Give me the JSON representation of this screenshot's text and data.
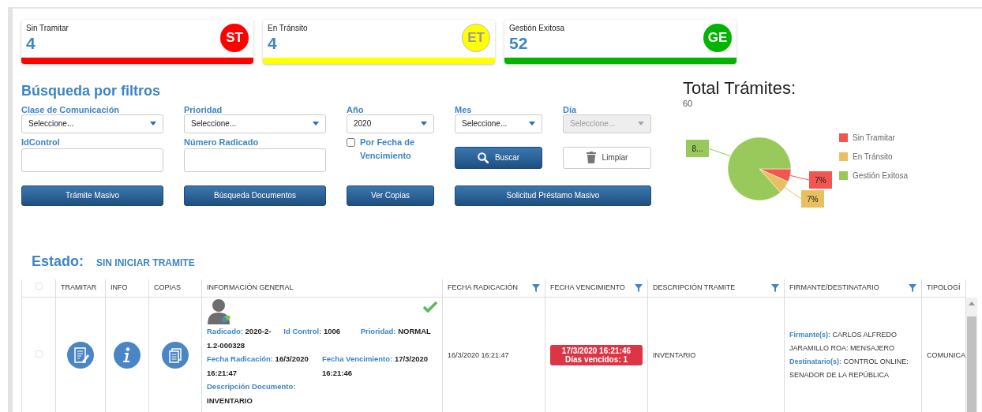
{
  "summary_cards": [
    {
      "label": "Sin Tramitar",
      "count": "4",
      "badge": "ST",
      "color": "#ff0000"
    },
    {
      "label": "En Tránsito",
      "count": "4",
      "badge": "ET",
      "color": "#ffff00"
    },
    {
      "label": "Gestión Exitosa",
      "count": "52",
      "badge": "GE",
      "color": "#00b400"
    }
  ],
  "filters": {
    "title": "Búsqueda por filtros",
    "items": [
      {
        "kind": "select",
        "label": "Clase de Comunicación",
        "value": "Seleccione...",
        "disabled": false
      },
      {
        "kind": "select",
        "label": "Prioridad",
        "value": "Seleccione...",
        "disabled": false
      },
      {
        "kind": "select",
        "label": "Año",
        "value": "2020",
        "disabled": false
      },
      {
        "kind": "select",
        "label": "Mes",
        "value": "Seleccione...",
        "disabled": false
      },
      {
        "kind": "select",
        "label": "Día",
        "value": "Seleccione...",
        "disabled": true
      },
      {
        "kind": "input",
        "label": "IdControl"
      },
      {
        "kind": "input",
        "label": "Número Radicado"
      },
      {
        "kind": "checkbox",
        "label": "Por Fecha de Vencimiento",
        "checked": false
      },
      {
        "kind": "search",
        "label": "Buscar"
      },
      {
        "kind": "clear",
        "label": "Limpiar"
      }
    ],
    "actions": [
      "Trámite Masivo",
      "Búsqueda Documentos",
      "Ver Copias",
      "Solicitud Préstamo Masivo"
    ]
  },
  "summary_chart": {
    "title": "Total Trámites:",
    "total": "60",
    "chart_data": {
      "type": "pie",
      "categories": [
        "Sin Tramitar",
        "En Tránsito",
        "Gestión Exitosa"
      ],
      "values": [
        6.7,
        6.7,
        86.6
      ],
      "colors": [
        "#f2564f",
        "#e8c061",
        "#99c95a"
      ],
      "value_labels": [
        "7%",
        "7%",
        "8..."
      ]
    }
  },
  "estado": {
    "label": "Estado:",
    "value": "SIN INICIAR TRAMITE"
  },
  "table": {
    "select_all_checked": false,
    "columns": [
      {
        "label": "TRAMITAR",
        "filterable": false
      },
      {
        "label": "INFO",
        "filterable": false
      },
      {
        "label": "COPIAS",
        "filterable": false
      },
      {
        "label": "INFORMACIÓN GENERAL",
        "filterable": false
      },
      {
        "label": "FECHA RADICACIÓN",
        "filterable": true
      },
      {
        "label": "FECHA VENCIMIENTO",
        "filterable": true
      },
      {
        "label": "DESCRIPCIÓN TRAMITE",
        "filterable": true
      },
      {
        "label": "FIRMANTE/DESTINATARIO",
        "filterable": true
      },
      {
        "label": "TIPOLOGÍ"
      }
    ],
    "rows": [
      {
        "checked": false,
        "verified": true,
        "info": [
          {
            "label": "Radicado:",
            "value": "2020-2-1.2-000328"
          },
          {
            "label": "Id Control:",
            "value": "1006"
          },
          {
            "label": "Prioridad:",
            "value": "NORMAL"
          },
          {
            "label": "Fecha Radicación:",
            "value": "16/3/2020 16:21:47"
          },
          {
            "label": "Fecha Vencimiento:",
            "value": "17/3/2020 16:21:46"
          },
          {
            "label": "Descripción Documento:",
            "value": "INVENTARIO"
          }
        ],
        "fecha_radicacion": "16/3/2020 16:21:47",
        "fecha_vencimiento": {
          "date": "17/3/2020 16:21:46",
          "note": "Días vencidos: 1",
          "overdue": true
        },
        "descripcion": "INVENTARIO",
        "firmante": [
          {
            "label": "Firmante(s):",
            "value": "CARLOS ALFREDO JARAMILLO ROA: MENSAJERO"
          },
          {
            "label": "Destinatario(s):",
            "value": "CONTROL ONLINE: SENADOR DE LA REPÚBLICA"
          }
        ],
        "tipologia": "COMUNICA"
      }
    ]
  }
}
